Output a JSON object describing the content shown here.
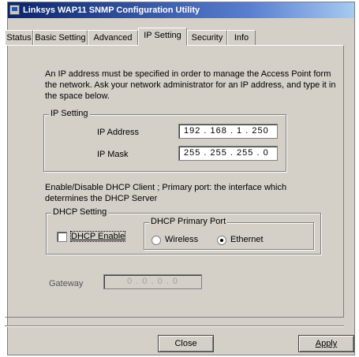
{
  "window": {
    "title": "Linksys WAP11 SNMP Configuration Utility"
  },
  "tabs": [
    {
      "label": "Status"
    },
    {
      "label": "Basic Setting"
    },
    {
      "label": "Advanced"
    },
    {
      "label": "IP Setting"
    },
    {
      "label": "Security"
    },
    {
      "label": "Info"
    }
  ],
  "active_tab": "IP Setting",
  "description": "An IP address must be specified in order to manage the Access Point form the network. Ask your network administrator for an IP address, and type it in the space below.",
  "ip_setting": {
    "group_label": "IP Setting",
    "ip_address_label": "IP Address",
    "ip_address_value": "192 . 168 .   1   . 250",
    "ip_mask_label": "IP Mask",
    "ip_mask_value": "255 . 255 . 255 .   0"
  },
  "dhcp_note": "Enable/Disable DHCP Client ; Primary port: the interface which determines the DHCP Server",
  "dhcp_setting": {
    "group_label": "DHCP Setting",
    "enable_label": "DHCP Enable",
    "enable_checked": false,
    "primary_port_label": "DHCP Primary Port",
    "wireless_label": "Wireless",
    "ethernet_label": "Ethernet",
    "selected_port": "Ethernet"
  },
  "gateway": {
    "label": "Gateway",
    "value": "0  .  0  .  0  .  0"
  },
  "buttons": {
    "close_label": "Close",
    "apply_label": "Apply"
  }
}
